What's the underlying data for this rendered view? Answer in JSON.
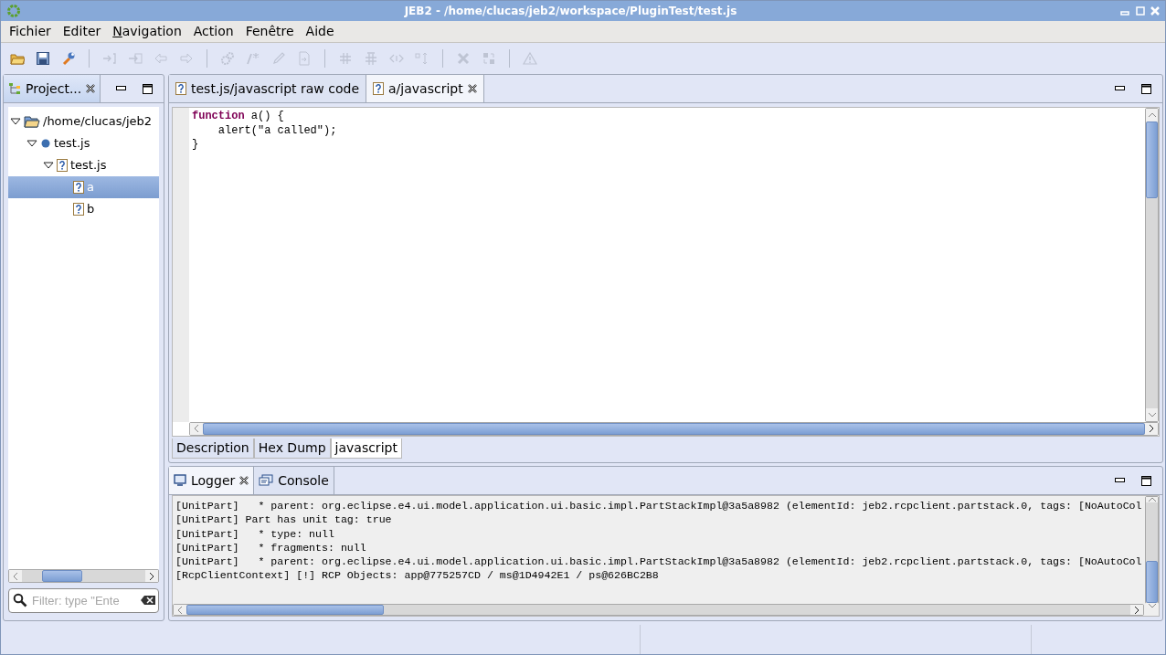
{
  "window": {
    "title": "JEB2 - /home/clucas/jeb2/workspace/PluginTest/test.js"
  },
  "menu": [
    {
      "label": "Fichier",
      "mnemonic_shown": false
    },
    {
      "label": "Editer",
      "mnemonic_shown": false
    },
    {
      "label": "Navigation",
      "mnemonic_shown": true
    },
    {
      "label": "Action",
      "mnemonic_shown": false
    },
    {
      "label": "Fenêtre",
      "mnemonic_shown": false
    },
    {
      "label": "Aide",
      "mnemonic_shown": false
    }
  ],
  "toolbar": [
    [
      {
        "kind": "folder",
        "disabled": false
      },
      {
        "kind": "save",
        "disabled": false
      },
      {
        "kind": "wrench",
        "disabled": false
      }
    ],
    [
      {
        "kind": "step-in",
        "disabled": true
      },
      {
        "kind": "step-out",
        "disabled": true
      },
      {
        "kind": "back",
        "disabled": true
      },
      {
        "kind": "forward",
        "disabled": true
      }
    ],
    [
      {
        "kind": "gears",
        "disabled": true
      },
      {
        "kind": "comment",
        "disabled": true
      },
      {
        "kind": "pencil",
        "disabled": true
      },
      {
        "kind": "doc",
        "disabled": true
      }
    ],
    [
      {
        "kind": "grid",
        "disabled": true
      },
      {
        "kind": "grid2",
        "disabled": true
      },
      {
        "kind": "code",
        "disabled": true
      },
      {
        "kind": "sort",
        "disabled": true
      }
    ],
    [
      {
        "kind": "delete",
        "disabled": true
      },
      {
        "kind": "swap",
        "disabled": true
      }
    ],
    [
      {
        "kind": "warning",
        "disabled": true
      }
    ]
  ],
  "project_panel": {
    "tab": {
      "label": "Project...",
      "selected": true
    },
    "tree": [
      {
        "label": "/home/clucas/jeb2",
        "kind": "folder",
        "expanded": true,
        "selected": false,
        "children": [
          {
            "label": "test.js",
            "kind": "dot",
            "expanded": true,
            "selected": false,
            "children": [
              {
                "label": "test.js",
                "kind": "unknown",
                "expanded": true,
                "selected": false,
                "children": [
                  {
                    "label": "a",
                    "kind": "unknown",
                    "selected": true
                  },
                  {
                    "label": "b",
                    "kind": "unknown",
                    "selected": false
                  }
                ]
              }
            ]
          }
        ]
      }
    ],
    "filter": {
      "placeholder": "Filter: type \"Ente"
    }
  },
  "editor": {
    "tabs": [
      {
        "label": "test.js/javascript raw code",
        "selected": false
      },
      {
        "label": "a/javascript",
        "selected": true
      }
    ],
    "code": [
      [
        {
          "text": "function",
          "kind": "keyword"
        },
        {
          "text": " a() {",
          "kind": "plain"
        }
      ],
      [
        {
          "text": "    alert(\"a called\");",
          "kind": "plain"
        }
      ],
      [
        {
          "text": "}",
          "kind": "plain"
        }
      ]
    ],
    "bottom_tabs": [
      {
        "label": "Description",
        "selected": false
      },
      {
        "label": "Hex Dump",
        "selected": false
      },
      {
        "label": "javascript",
        "selected": true
      }
    ]
  },
  "console_panel": {
    "tabs": [
      {
        "label": "Logger",
        "kind": "monitor",
        "selected": true
      },
      {
        "label": "Console",
        "kind": "console",
        "selected": false
      }
    ],
    "lines": [
      "[UnitPart]   * parent: org.eclipse.e4.ui.model.application.ui.basic.impl.PartStackImpl@3a5a8982 (elementId: jeb2.rcpclient.partstack.0, tags: [NoAutoCol",
      "[UnitPart] Part has unit tag: true",
      "[UnitPart]   * type: null",
      "[UnitPart]   * fragments: null",
      "[UnitPart]   * parent: org.eclipse.e4.ui.model.application.ui.basic.impl.PartStackImpl@3a5a8982 (elementId: jeb2.rcpclient.partstack.0, tags: [NoAutoCol",
      "[RcpClientContext] [!] RCP Objects: app@775257CD / ms@1D4942E1 / ps@626BC2B8"
    ]
  }
}
